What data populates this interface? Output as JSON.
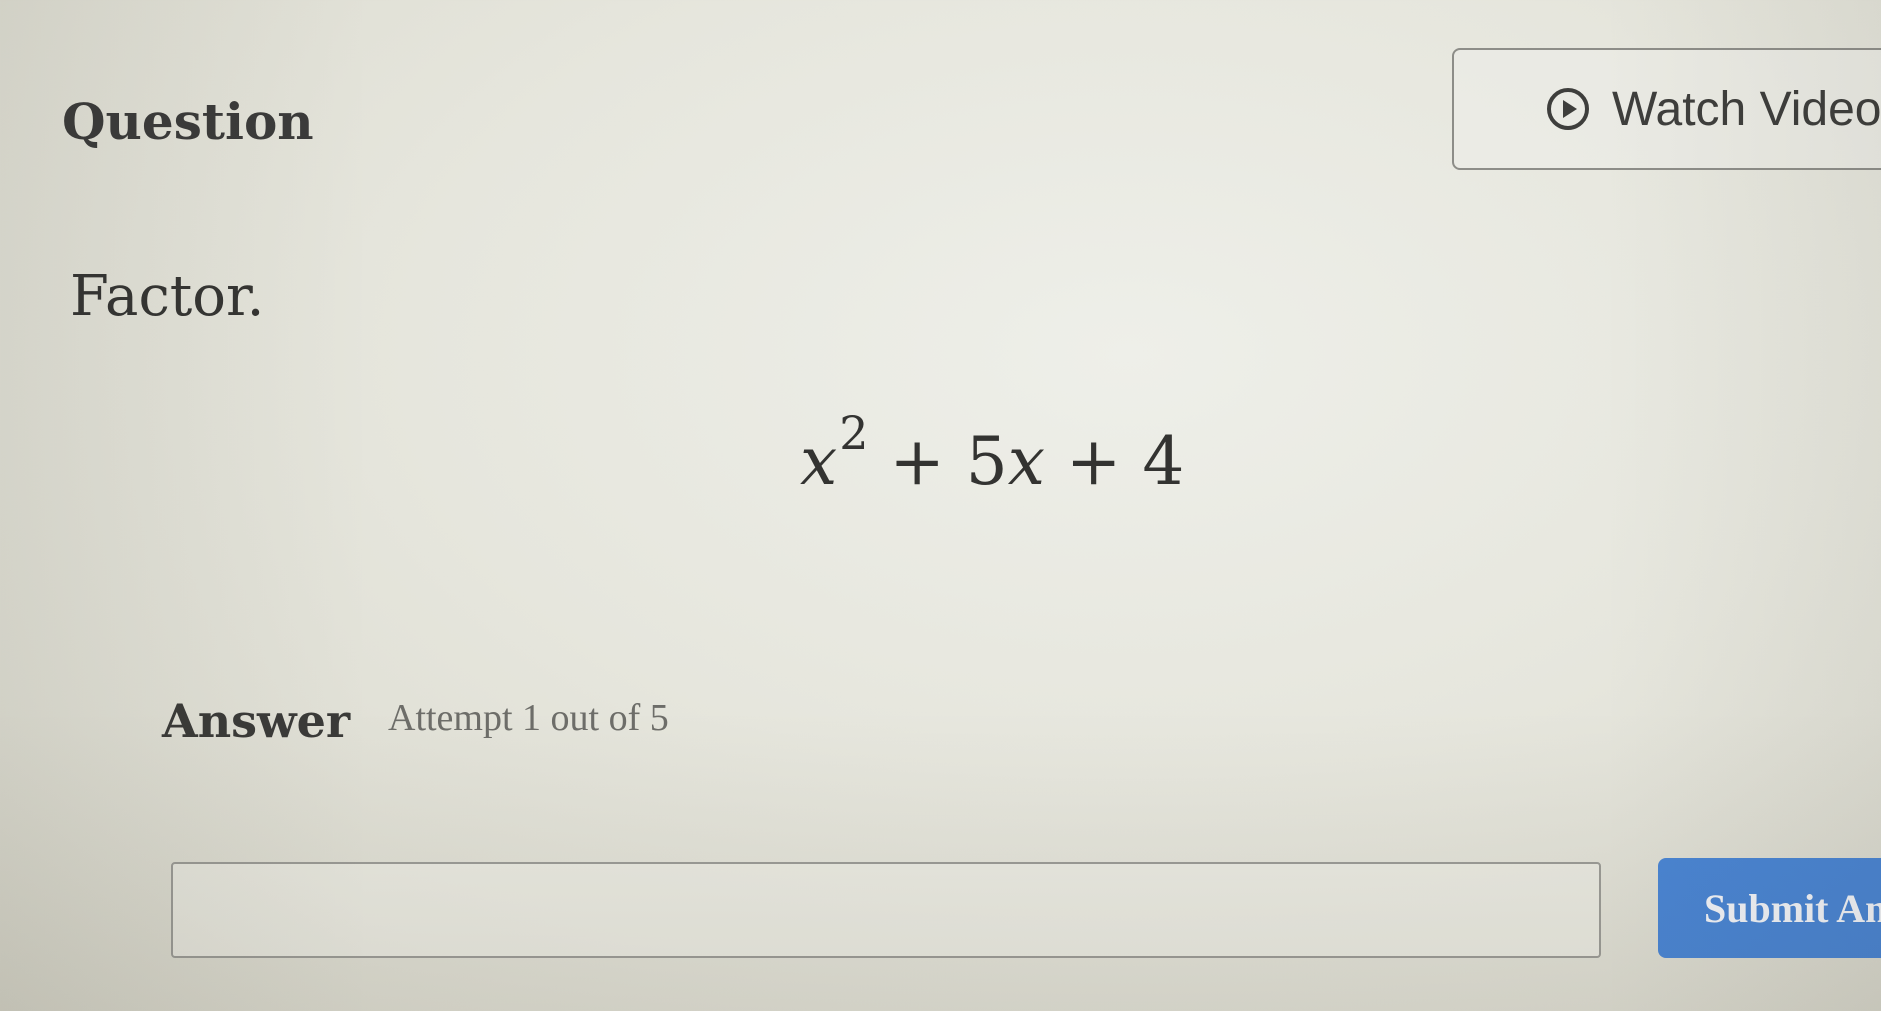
{
  "header": {
    "title": "Question",
    "watch_video": {
      "label": "Watch Video",
      "icon": "play-circle-icon"
    }
  },
  "question": {
    "instruction": "Factor.",
    "expression": {
      "term1_var": "x",
      "term1_exp": "2",
      "op1": "+",
      "term2_coef": "5",
      "term2_var": "x",
      "op2": "+",
      "constant": "4"
    }
  },
  "answer": {
    "heading": "Answer",
    "attempt_text": "Attempt 1 out of 5",
    "input_value": "",
    "submit_label": "Submit Answer"
  },
  "colors": {
    "submit_button": "#4a86d6",
    "background": "#e6e6dd"
  }
}
